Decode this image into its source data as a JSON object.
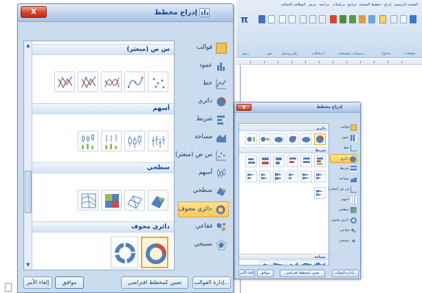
{
  "main_dialog": {
    "title": "إدراج مخطط",
    "close_label": "X",
    "categories": [
      {
        "label": "قوالب",
        "icon": "folder-icon"
      },
      {
        "label": "عمود",
        "icon": "column-chart-icon"
      },
      {
        "label": "خط",
        "icon": "line-chart-icon"
      },
      {
        "label": "دائري",
        "icon": "pie-chart-icon"
      },
      {
        "label": "شريط",
        "icon": "bar-chart-icon"
      },
      {
        "label": "مساحة",
        "icon": "area-chart-icon"
      },
      {
        "label": "س ص (مبعثر)",
        "icon": "scatter-chart-icon"
      },
      {
        "label": "أسهم",
        "icon": "stock-chart-icon"
      },
      {
        "label": "سطحي",
        "icon": "surface-chart-icon"
      },
      {
        "label": "دائري مجوف",
        "icon": "doughnut-chart-icon"
      },
      {
        "label": "فقاعي",
        "icon": "bubble-chart-icon"
      },
      {
        "label": "نسيجي",
        "icon": "radar-chart-icon"
      }
    ],
    "selected_category": "دائري مجوف",
    "gallery_sections": [
      {
        "title": "س ص (مبعثر)"
      },
      {
        "title": "أسهم"
      },
      {
        "title": "سطحي"
      },
      {
        "title": "دائري مجوف"
      }
    ],
    "buttons": {
      "manage_templates": "إدارة القوالب...",
      "set_default": "تعيين كمخطط افتراضي",
      "ok": "موافق",
      "cancel": "إلغاء الأمر"
    }
  },
  "small_dialog": {
    "title": "إدراج مخطط",
    "close_label": "X",
    "categories": [
      {
        "label": "قوالب"
      },
      {
        "label": "عمود"
      },
      {
        "label": "خط"
      },
      {
        "label": "دائري"
      },
      {
        "label": "شريط"
      },
      {
        "label": "مساحة"
      },
      {
        "label": "س ص (مبعثر)"
      },
      {
        "label": "أسهم"
      },
      {
        "label": "سطحي"
      },
      {
        "label": "دائري مجوف"
      },
      {
        "label": "فقاعي"
      },
      {
        "label": "نسيجي"
      }
    ],
    "selected_category": "دائري",
    "gallery_sections": [
      {
        "title": "دائري"
      },
      {
        "title": "شريط"
      },
      {
        "title": "مساحة"
      }
    ],
    "buttons": {
      "manage_templates": "إدارة القوالب...",
      "set_default": "تعيين كمخطط افتراضي",
      "ok": "موافق",
      "cancel": "إلغاء الأمر"
    }
  },
  "word_ribbon": {
    "tabs": [
      "الصفحة الرئيسية",
      "إدراج",
      "تخطيط الصفحة",
      "مراجع",
      "مراسلات",
      "مراجعة",
      "عرض",
      "الوظائف الإضافية"
    ],
    "groups": [
      "صفحات",
      "جداول",
      "رسومات توضيحية",
      "ارتباطات",
      "رأس وتذييل",
      "نص",
      "رموز"
    ]
  },
  "colors": {
    "dialog_bg": "#cbdcef",
    "title_text": "#15428b",
    "selected_fill": "#ffc95a",
    "close_red": "#d2472a"
  }
}
